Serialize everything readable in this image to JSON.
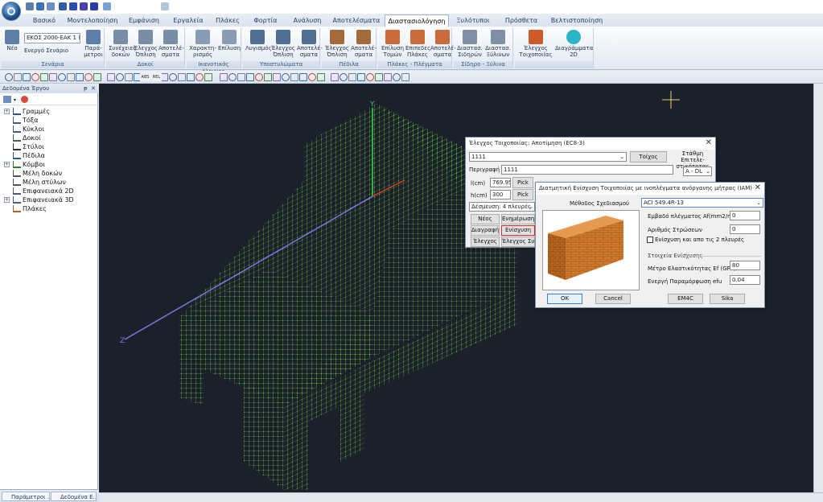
{
  "qat": {
    "logo": "app-logo",
    "icons": [
      "save-icon",
      "open-icon",
      "print-icon",
      "undo-icon",
      "redo-icon"
    ]
  },
  "ribbon_tabs": [
    "Βασικό",
    "Μοντελοποίηση",
    "Εμφάνιση",
    "Εργαλεία",
    "Πλάκες",
    "Φορτία",
    "Ανάλυση",
    "Αποτελέσματα",
    "Διαστασιολόγηση",
    "Ξυλότυποι",
    "Πρόσθετα",
    "Βελτιστοποίηση"
  ],
  "active_tab": "Διαστασιολόγηση",
  "ribbon": {
    "groups": [
      {
        "label": "Σενάρια",
        "buttons": [
          {
            "l1": "Νέο",
            "l2": ""
          },
          {
            "l1": "Ενεργό Σενάριο",
            "l2": ""
          },
          {
            "l1": "Παρά-",
            "l2": "μετροι"
          }
        ],
        "combo": "ΕΚΟΣ 2000-ΕΑΚ 1 (Ε"
      },
      {
        "label": "Δοκοί",
        "buttons": [
          {
            "l1": "Συνέχειες",
            "l2": "δοκών"
          },
          {
            "l1": "Έλεγχος",
            "l2": "Όπλιση"
          },
          {
            "l1": "Αποτελέ-",
            "l2": "σματα"
          }
        ]
      },
      {
        "label": "Ικανοτικός έλεγχος",
        "buttons": [
          {
            "l1": "Χαρακτη-",
            "l2": "ρισμός"
          },
          {
            "l1": "Επίλυση",
            "l2": ""
          }
        ]
      },
      {
        "label": "Υποστυλώματα",
        "buttons": [
          {
            "l1": "Λυγισμός",
            "l2": ""
          },
          {
            "l1": "Έλεγχος",
            "l2": "Όπλιση"
          },
          {
            "l1": "Αποτελέ-",
            "l2": "σματα"
          }
        ]
      },
      {
        "label": "Πέδιλα",
        "buttons": [
          {
            "l1": "Έλεγχος",
            "l2": "Όπλιση"
          },
          {
            "l1": "Αποτελέ-",
            "l2": "σματα"
          }
        ]
      },
      {
        "label": "Πλάκες - Πλέγματα",
        "buttons": [
          {
            "l1": "Επίλυση",
            "l2": "Τομών"
          },
          {
            "l1": "Επιπεδες",
            "l2": "Πλάκες"
          },
          {
            "l1": "Αποτελέ-",
            "l2": "σματα"
          }
        ]
      },
      {
        "label": "Σίδηρο - Ξύλινα",
        "buttons": [
          {
            "l1": "Διαστασ.",
            "l2": "Σιδηρών"
          },
          {
            "l1": "Διαστασ.",
            "l2": "Ξύλινων"
          }
        ]
      },
      {
        "label": "",
        "buttons": [
          {
            "l1": "Έλεγχος",
            "l2": "Τοιχοποιίας"
          },
          {
            "l1": "Διαγράμματα",
            "l2": "2D"
          }
        ]
      }
    ]
  },
  "toolbar": {
    "icons": [
      "line-icon",
      "polyline-icon",
      "node-icon",
      "snap-icon",
      "grid-icon",
      "zoom-in-icon",
      "zoom-out-icon",
      "zoom-window-icon",
      "pan-icon",
      "refresh-icon",
      "undo-view-icon",
      "redo-view-icon",
      "delete-icon"
    ],
    "labels": [
      "ABS",
      "REL"
    ]
  },
  "left_panel": {
    "title": "Δεδομένα Έργου",
    "pin": "ᵽ",
    "close": "✕",
    "tree": [
      {
        "label": "Γραμμές",
        "expandable": true,
        "icon": "line-icon"
      },
      {
        "label": "Τόξα",
        "expandable": false,
        "icon": "arc-icon"
      },
      {
        "label": "Κύκλοι",
        "expandable": false,
        "icon": "circle-icon"
      },
      {
        "label": "Δοκοί",
        "expandable": false,
        "icon": "beam-icon"
      },
      {
        "label": "Στύλοι",
        "expandable": false,
        "icon": "column-icon"
      },
      {
        "label": "Πέδιλα",
        "expandable": false,
        "icon": "footing-icon"
      },
      {
        "label": "Κόμβοι",
        "expandable": true,
        "icon": "node-icon"
      },
      {
        "label": "Μέλη δοκών",
        "expandable": false,
        "icon": "beam-member-icon"
      },
      {
        "label": "Μέλη στύλων",
        "expandable": false,
        "icon": "column-member-icon"
      },
      {
        "label": "Επιφανειακά 2D",
        "expandable": false,
        "icon": "surface-2d-icon"
      },
      {
        "label": "Επιφανειακά 3D",
        "expandable": true,
        "icon": "surface-3d-icon"
      },
      {
        "label": "Πλάκες",
        "expandable": false,
        "icon": "slab-icon"
      }
    ],
    "bottom_tabs": [
      "Παράμετροι ...",
      "Δεδομένα Ε..."
    ]
  },
  "viewport": {
    "axes": {
      "y": "Y",
      "z": "Z"
    },
    "mesh_color": "#69e534",
    "axis_y_color": "#33d14a",
    "axis_z_color": "#7b7de8",
    "background": "#1b202a"
  },
  "dialog_check": {
    "title": "Έλεγχος Τοιχοποιίας: Αποτίμηση (ΕC8-3)",
    "close": "✕",
    "wall_select": "1111",
    "walls_button": "Τοίχος",
    "description_label": "Περιγραφή",
    "description_value": "1111",
    "l_label": "l(cm)",
    "l_value": "769.95",
    "h_label": "h(cm)",
    "h_value": "300",
    "pick_label": "Pick",
    "restraint_label": "Δέσμευση: 4 πλευρές",
    "performance_label": "Στάθμη Επιτελε-στικότητας",
    "performance_value": "A - DL",
    "buttons": {
      "new": "Νέος",
      "update": "Ενημέρωση",
      "delete": "Διαγραφή",
      "reinforce": "Ενίσχυση",
      "check": "Έλεγχος",
      "check_wall": "Έλεγχος Συν"
    }
  },
  "dialog_reinforce": {
    "title": "Διατμητική Ενίσχυση Τοιχοποιίας με ινοπλέγματα ανόργανης μήτρας (IAM)",
    "close": "✕",
    "method_label": "Μέθοδος Σχεδιασμού",
    "method_value": "ACI 549.4R-13",
    "area_label": "Εμβαδό πλέγματος Af(mm2/m)",
    "area_value": "0",
    "layers_label": "Αριθμός Στρώσεων",
    "layers_value": "0",
    "both_sides_label": "Ενίσχυση και απο τις 2 πλευρές",
    "both_sides_checked": false,
    "section_label": "Στοιχεία Ενίσχυσης",
    "modulus_label": "Μέτρο Ελαστικότητας Ef (GPa)",
    "modulus_value": "80",
    "strain_label": "Ενεργή Παραμόρφωση efu",
    "strain_value": "0.04",
    "ok": "OK",
    "cancel": "Cancel",
    "em4c": "EM4C",
    "sika": "Sika",
    "wall_image_color": "#d07a2d"
  }
}
